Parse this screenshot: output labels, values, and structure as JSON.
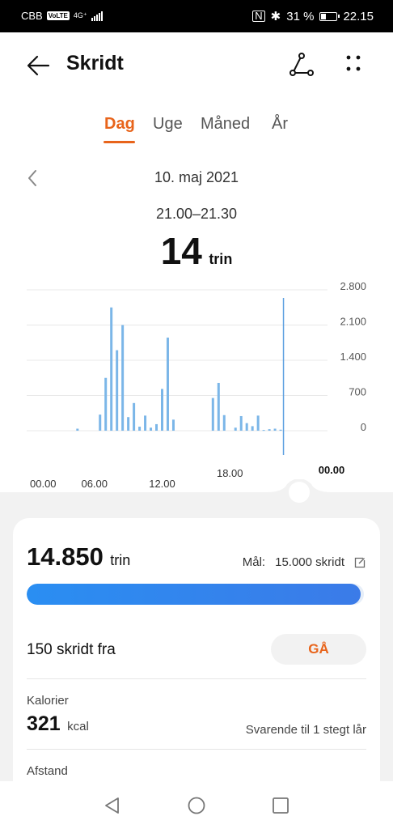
{
  "status_bar": {
    "carrier": "CBB",
    "volte": "VoLTE",
    "network": "4G⁺",
    "battery": "31 %",
    "time": "22.15"
  },
  "header": {
    "title": "Skridt",
    "back_icon": "arrow-left-icon",
    "share_icon": "share-icon",
    "more_icon": "more-dots-icon"
  },
  "tabs": [
    {
      "label": "Dag",
      "active": true
    },
    {
      "label": "Uge",
      "active": false
    },
    {
      "label": "Måned",
      "active": false
    },
    {
      "label": "År",
      "active": false
    }
  ],
  "date": {
    "label": "10. maj 2021"
  },
  "selection": {
    "time_range": "21.00–21.30",
    "steps": "14",
    "unit": "trin"
  },
  "chart_data": {
    "type": "bar",
    "x_tick_labels": [
      "00.00",
      "06.00",
      "12.00",
      "18.00",
      "00.00"
    ],
    "y_tick_labels": [
      "2.800",
      "2.100",
      "1.400",
      "700",
      "0"
    ],
    "ylim": [
      0,
      2800
    ],
    "grid": true,
    "x_domain": [
      0,
      24
    ],
    "bin_hours": 0.5,
    "values": [
      [
        4.5,
        40
      ],
      [
        6.5,
        320
      ],
      [
        7.0,
        1050
      ],
      [
        7.5,
        2450
      ],
      [
        8.0,
        1600
      ],
      [
        8.5,
        2100
      ],
      [
        9.0,
        270
      ],
      [
        9.5,
        550
      ],
      [
        10.0,
        80
      ],
      [
        10.5,
        300
      ],
      [
        11.0,
        60
      ],
      [
        11.5,
        130
      ],
      [
        12.0,
        830
      ],
      [
        12.5,
        1850
      ],
      [
        13.0,
        220
      ],
      [
        16.5,
        650
      ],
      [
        17.0,
        950
      ],
      [
        17.5,
        310
      ],
      [
        18.5,
        60
      ],
      [
        19.0,
        290
      ],
      [
        19.5,
        150
      ],
      [
        20.0,
        90
      ],
      [
        20.5,
        300
      ],
      [
        21.0,
        14
      ],
      [
        21.5,
        30
      ],
      [
        22.0,
        40
      ],
      [
        22.5,
        20
      ]
    ],
    "bar_color": "#7bb6e8",
    "selected_x": 22.75
  },
  "summary": {
    "total": "14.850",
    "total_unit": "trin",
    "goal_label": "Mål:",
    "goal_value": "15.000 skridt",
    "progress_fraction": 0.99,
    "remaining_text": "150 skridt fra",
    "go_button": "GÅ"
  },
  "calories": {
    "label": "Kalorier",
    "value": "321",
    "unit": "kcal",
    "equivalent": "Svarende til 1 stegt lår"
  },
  "distance": {
    "label": "Afstand"
  },
  "colors": {
    "accent": "#e8641b",
    "progress": "#2a8ef2",
    "bars": "#7bb6e8"
  }
}
